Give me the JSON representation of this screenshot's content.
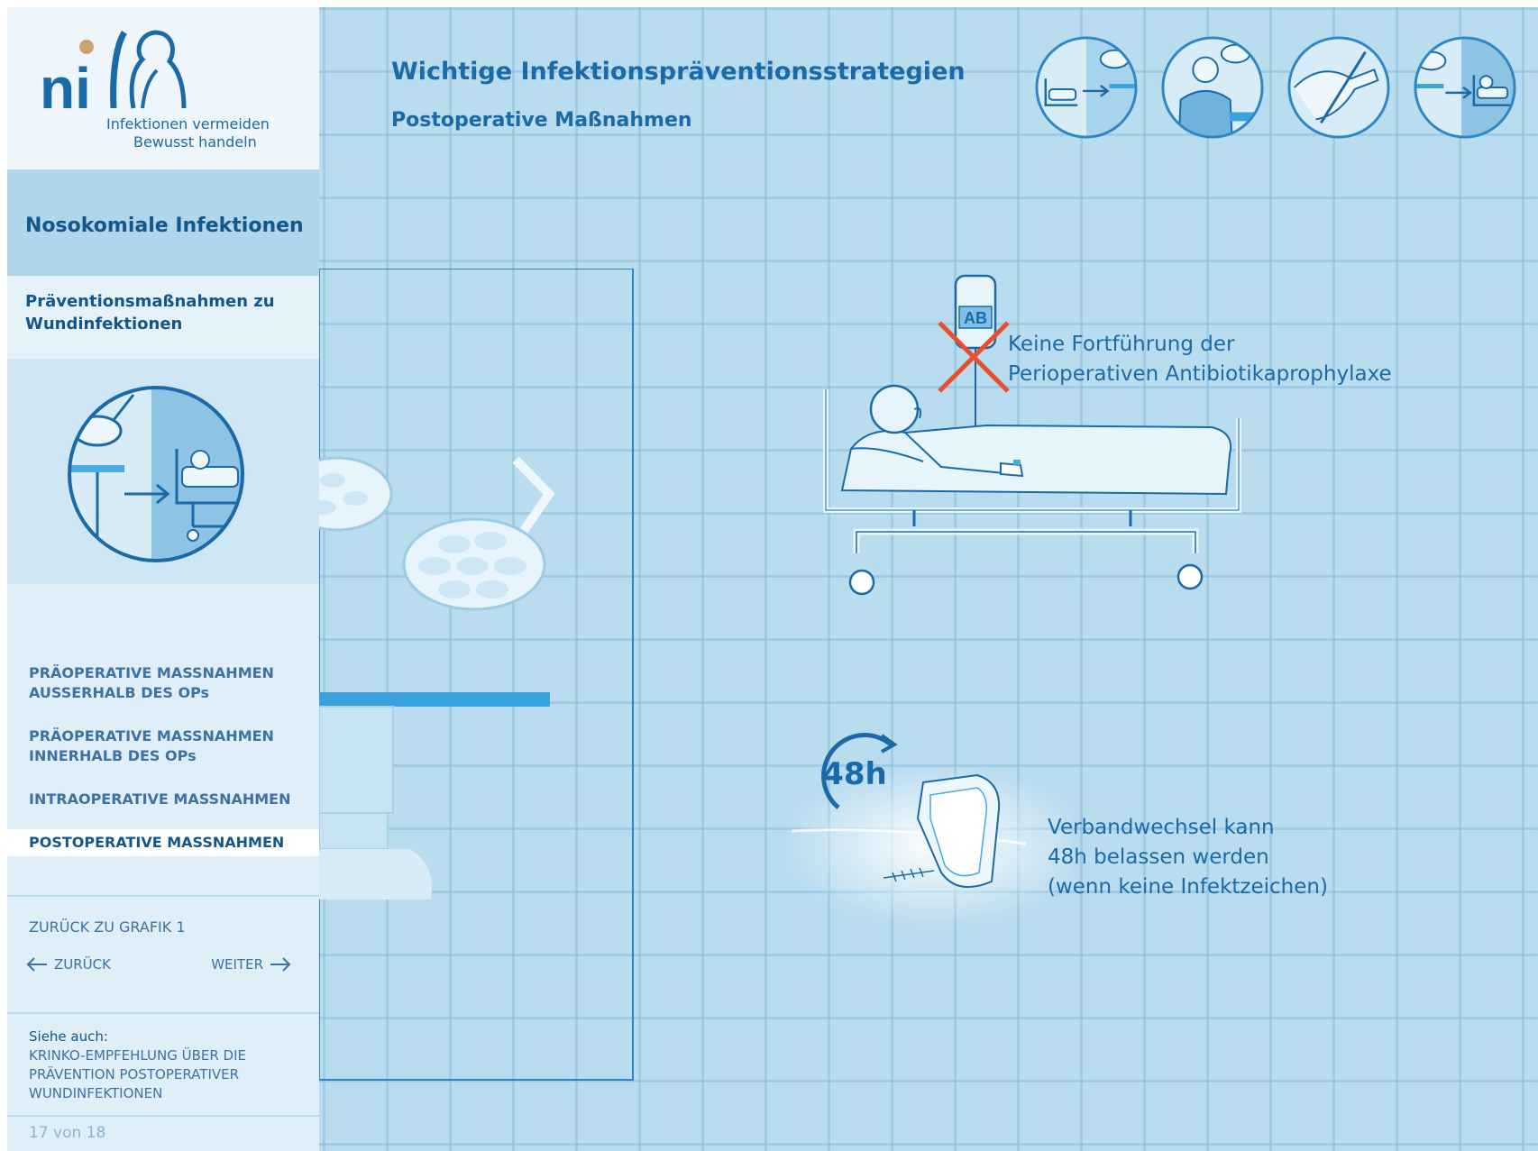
{
  "brand": {
    "logo_text": "ni",
    "tagline_1": "Infektionen vermeiden",
    "tagline_2": "Bewusst handeln"
  },
  "sidebar": {
    "section_title": "Nosokomiale Infektionen",
    "topic_title": "Präventionsmaßnahmen zu Wundinfektionen",
    "nav_items": [
      {
        "line1": "PRÄOPERATIVE MASSNAHMEN",
        "line2": "AUSSERHALB DES OPs"
      },
      {
        "line1": "PRÄOPERATIVE MASSNAHMEN",
        "line2": "INNERHALB DES OPs"
      },
      {
        "line1": "INTRAOPERATIVE MASSNAHMEN"
      },
      {
        "line1": "POSTOPERATIVE MASSNAHMEN",
        "active": true
      }
    ],
    "back_to_graphic": "ZURÜCK ZU GRAFIK 1",
    "prev_label": "ZURÜCK",
    "next_label": "WEITER",
    "see_also_label": "Siehe auch:",
    "see_also_link": "KRINKO-EMPFEHLUNG ÜBER DIE PRÄVENTION POSTOPERATIVER WUNDINFEKTIONEN",
    "page_counter": "17 von 18"
  },
  "header": {
    "title": "Wichtige Infektionspräventionsstrategien",
    "subtitle": "Postoperative Maßnahmen",
    "icons": [
      "transfer-from-op-icon",
      "surgeon-icon",
      "hand-disinfection-icon",
      "transfer-to-ward-icon"
    ]
  },
  "main": {
    "iv_label": "AB",
    "antibiotic_text_1": "Keine Fortführung der",
    "antibiotic_text_2": "Perioperativen Antibiotikaprophylaxe",
    "clock_label": "48h",
    "dressing_text_1": "Verbandwechsel kann",
    "dressing_text_2": "48h belassen werden",
    "dressing_text_3": "(wenn keine Infektzeichen)"
  },
  "colors": {
    "primary": "#1a6aa8",
    "dark": "#13568c",
    "nav": "#3e72a3",
    "background": "#b9dcef",
    "cross": "#e8502d"
  }
}
